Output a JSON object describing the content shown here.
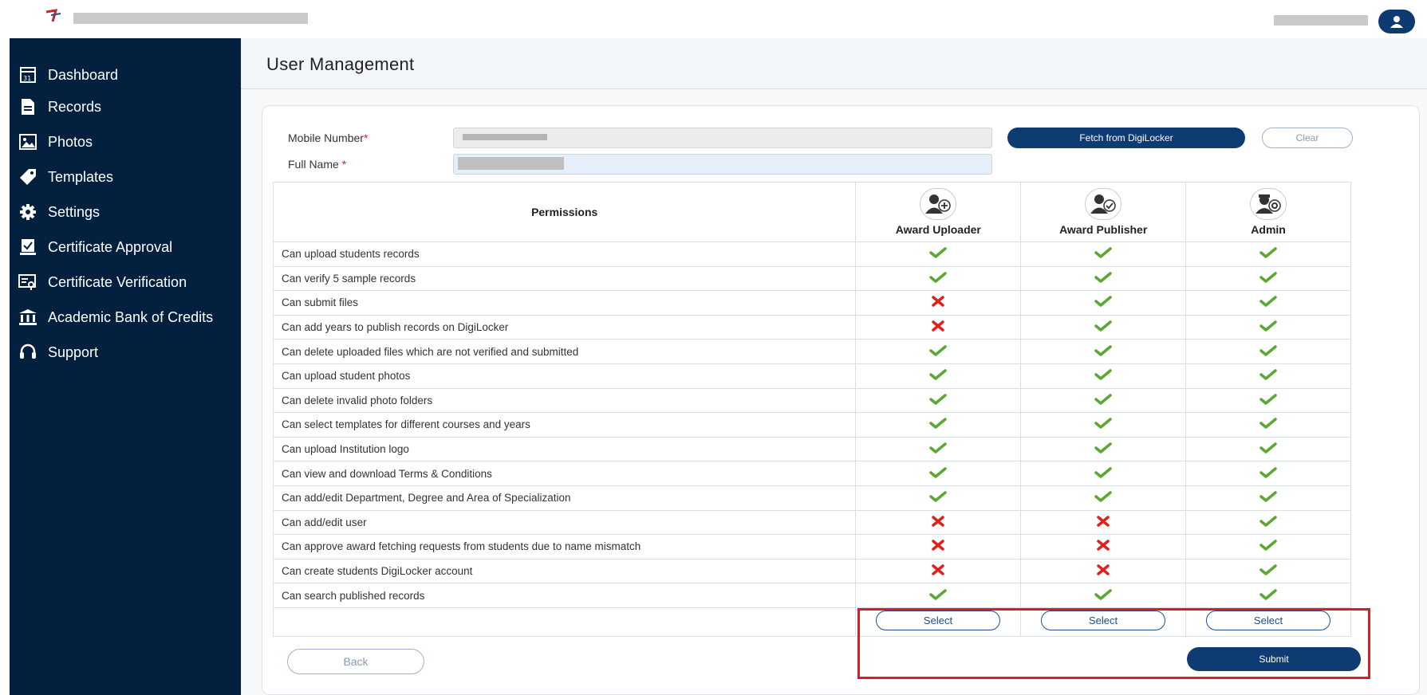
{
  "header": {
    "title": "User Management"
  },
  "sidebar": {
    "items": [
      {
        "label": "Dashboard",
        "icon": "calendar-icon"
      },
      {
        "label": "Records",
        "icon": "document-icon"
      },
      {
        "label": "Photos",
        "icon": "image-icon"
      },
      {
        "label": "Templates",
        "icon": "tag-icon"
      },
      {
        "label": "Settings",
        "icon": "gear-icon"
      },
      {
        "label": "Certificate Approval",
        "icon": "approval-icon"
      },
      {
        "label": "Certificate Verification",
        "icon": "verification-icon"
      },
      {
        "label": "Academic Bank of Credits",
        "icon": "bank-icon"
      },
      {
        "label": "Support",
        "icon": "headset-icon"
      }
    ]
  },
  "form": {
    "mobile_label": "Mobile Number",
    "fullname_label": "Full Name ",
    "required_mark": "*",
    "fetch_button": "Fetch from DigiLocker",
    "clear_button": "Clear"
  },
  "table": {
    "permissions_header": "Permissions",
    "roles": [
      "Award Uploader",
      "Award Publisher",
      "Admin"
    ],
    "rows": [
      {
        "label": "Can upload students records",
        "values": [
          true,
          true,
          true
        ]
      },
      {
        "label": "Can verify 5 sample records",
        "values": [
          true,
          true,
          true
        ]
      },
      {
        "label": "Can submit files",
        "values": [
          false,
          true,
          true
        ]
      },
      {
        "label": "Can add years to publish records on DigiLocker",
        "values": [
          false,
          true,
          true
        ]
      },
      {
        "label": "Can delete uploaded files which are not verified and submitted",
        "values": [
          true,
          true,
          true
        ]
      },
      {
        "label": "Can upload student photos",
        "values": [
          true,
          true,
          true
        ]
      },
      {
        "label": "Can delete invalid photo folders",
        "values": [
          true,
          true,
          true
        ]
      },
      {
        "label": "Can select templates for different courses and years",
        "values": [
          true,
          true,
          true
        ]
      },
      {
        "label": "Can upload Institution logo",
        "values": [
          true,
          true,
          true
        ]
      },
      {
        "label": "Can view and download Terms & Conditions",
        "values": [
          true,
          true,
          true
        ]
      },
      {
        "label": "Can add/edit Department, Degree and Area of Specialization",
        "values": [
          true,
          true,
          true
        ]
      },
      {
        "label": "Can add/edit user",
        "values": [
          false,
          false,
          true
        ]
      },
      {
        "label": "Can approve award fetching requests from students due to name mismatch",
        "values": [
          false,
          false,
          true
        ]
      },
      {
        "label": "Can create students DigiLocker account",
        "values": [
          false,
          false,
          true
        ]
      },
      {
        "label": "Can search published records",
        "values": [
          true,
          true,
          true
        ]
      }
    ],
    "select_label": "Select"
  },
  "footer": {
    "back_button": "Back",
    "submit_button": "Submit"
  },
  "colors": {
    "sidebar": "#04203f",
    "primary": "#0d3b72",
    "check": "#5aa832",
    "cross": "#e0211b",
    "highlight": "#e01a22"
  }
}
